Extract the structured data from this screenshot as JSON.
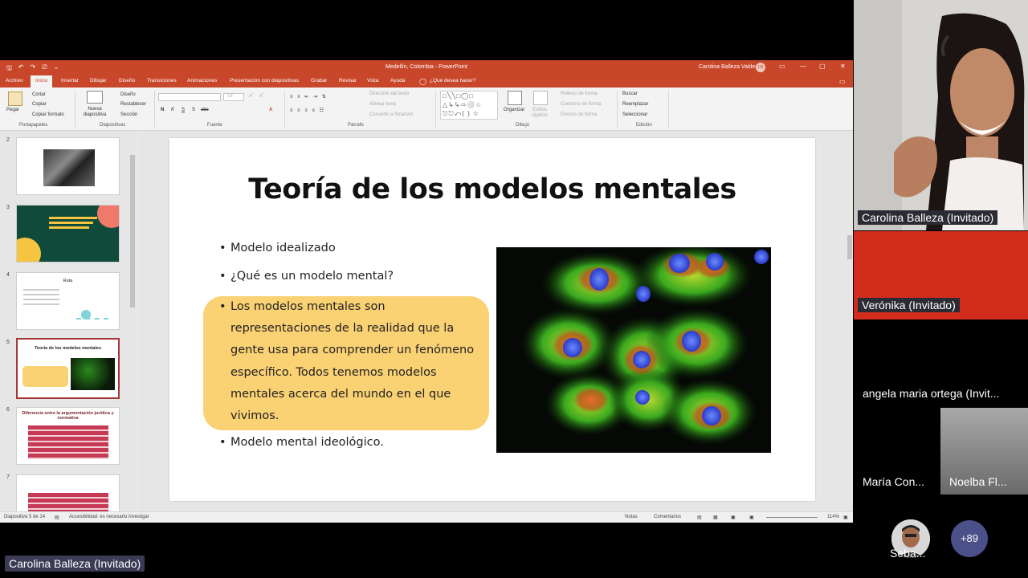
{
  "powerpoint": {
    "titlebar": {
      "doc_title": "Medellín, Colombia  -  PowerPoint",
      "user_name": "Carolina Balleza Valdez",
      "user_initials": "CB",
      "qat_save": "🖫",
      "qat_undo": "↶",
      "qat_redo": "↷",
      "qat_start": "⎚",
      "qat_more": "⌄",
      "ribbon_opts": "▭",
      "minimize": "—",
      "restore": "▢",
      "close": "✕",
      "share": "▭"
    },
    "tabs": [
      {
        "label": "Archivo"
      },
      {
        "label": "Inicio"
      },
      {
        "label": "Insertar"
      },
      {
        "label": "Dibujar"
      },
      {
        "label": "Diseño"
      },
      {
        "label": "Transiciones"
      },
      {
        "label": "Animaciones"
      },
      {
        "label": "Presentación con diapositivas"
      },
      {
        "label": "Grabar"
      },
      {
        "label": "Revisar"
      },
      {
        "label": "Vista"
      },
      {
        "label": "Ayuda"
      },
      {
        "label": "¿Qué desea hacer?"
      }
    ],
    "ribbon": {
      "clipboard": {
        "paste": "Pegar",
        "cut": "Cortar",
        "copy": "Copiar",
        "format_painter": "Copiar formato",
        "label": "Portapapeles"
      },
      "slides": {
        "new_slide": "Nueva diapositiva",
        "layout": "Diseño",
        "reset": "Restablecer",
        "section": "Sección",
        "label": "Diapositivas"
      },
      "font": {
        "size": "18",
        "bold": "N",
        "italic": "K",
        "underline": "S",
        "strike": "S",
        "shadow": "abc",
        "label": "Fuente"
      },
      "paragraph": {
        "text_direction": "Dirección del texto",
        "align_text": "Alinear texto",
        "smartart": "Convertir a SmartArt",
        "label": "Párrafo"
      },
      "drawing": {
        "arrange": "Organizar",
        "quick_styles": "Estilos rápidos",
        "shape_fill": "Relleno de forma",
        "shape_outline": "Contorno de forma",
        "shape_effects": "Efectos de forma",
        "label": "Dibujo"
      },
      "editing": {
        "find": "Buscar",
        "replace": "Reemplazar",
        "select": "Seleccionar",
        "label": "Edición"
      }
    },
    "thumbnails": [
      {
        "number": "2"
      },
      {
        "number": "3"
      },
      {
        "number": "4",
        "title": "Ruta"
      },
      {
        "number": "5",
        "title": "Teoría de los modelos mentales"
      },
      {
        "number": "6",
        "title": "Diferencia entre la argumentación jurídica y normativa"
      },
      {
        "number": "7"
      }
    ],
    "slide": {
      "title": "Teoría de los modelos mentales",
      "bullets": [
        "Modelo idealizado",
        "¿Qué es un modelo mental?",
        "Los modelos mentales son representaciones de la realidad que la gente usa para comprender un fenómeno específico. Todos tenemos modelos mentales acerca del mundo en el que vivimos.",
        "Modelo mental ideológico."
      ],
      "bullet_glyph": "•",
      "highlight_color": "#fad173"
    },
    "statusbar": {
      "slide_position": "Diapositiva 5 de 14",
      "accessibility": "Accesibilidad: es necesario investigar",
      "notes": "Notas",
      "comments": "Comentarios",
      "zoom": "114%"
    }
  },
  "meeting": {
    "speaker": "Carolina Balleza (Invitado)",
    "participants": [
      {
        "name": "Verónika (Invitado)"
      },
      {
        "name": "angela maria ortega (Invit..."
      },
      {
        "name": "María Con..."
      },
      {
        "name": "Noelba Fl..."
      },
      {
        "name": "Seba..."
      }
    ],
    "presenter_label": "Carolina Balleza (Invitado)",
    "more_count": "+89",
    "red_tile_color": "#d22d1c"
  }
}
